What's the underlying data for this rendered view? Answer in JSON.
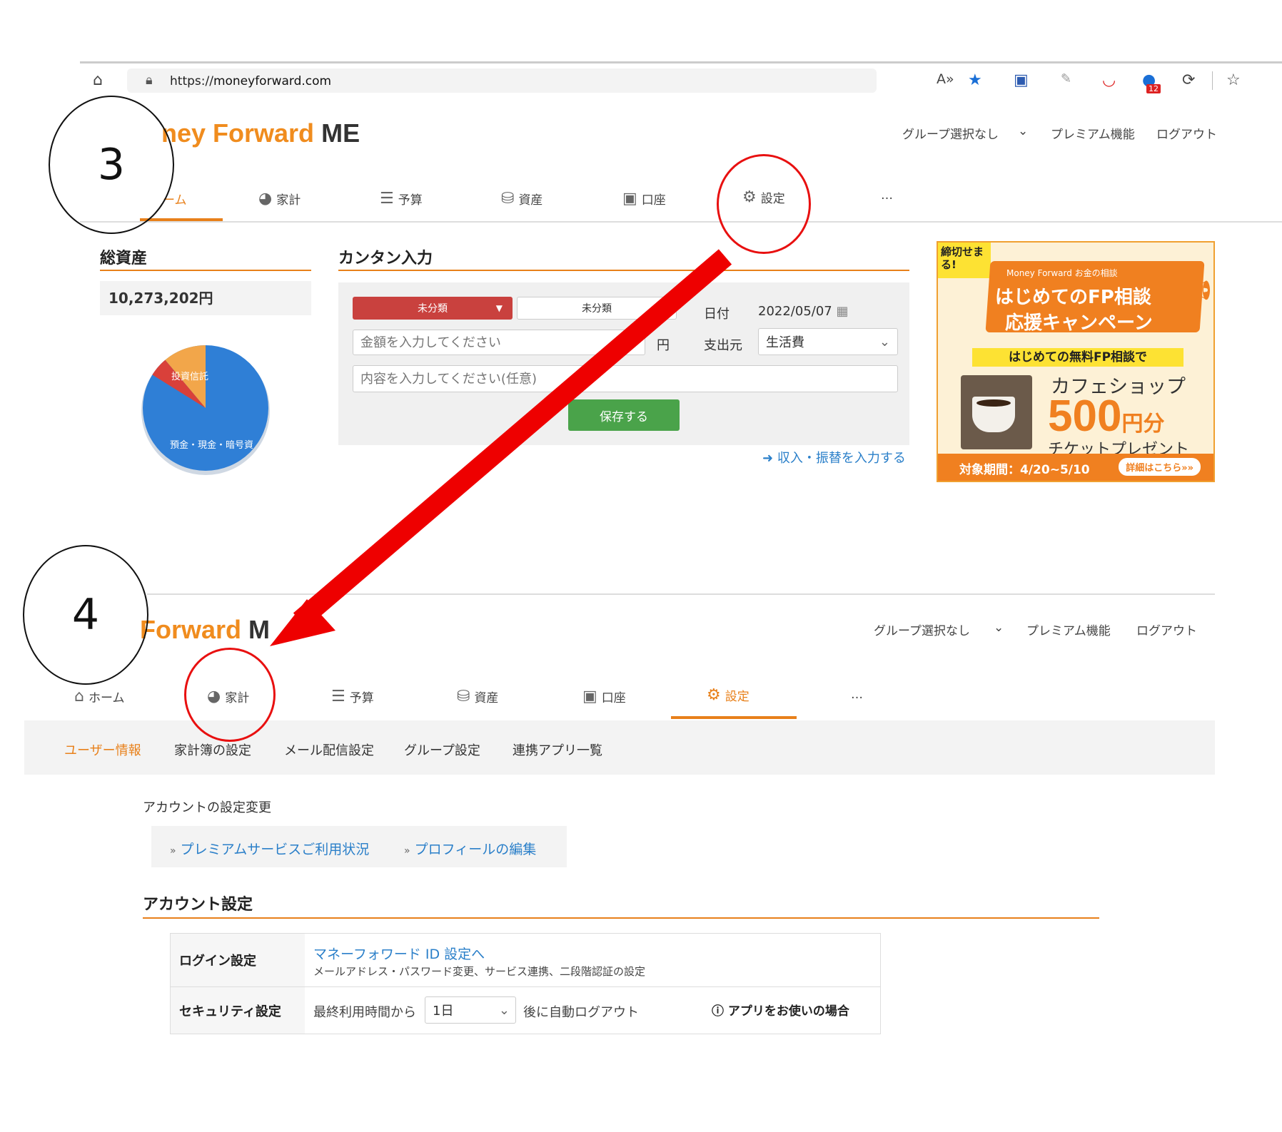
{
  "browser": {
    "url_prefix": "https://",
    "url_host": "moneyforward.com",
    "badge_count": "12"
  },
  "screen3": {
    "logo_main": "ney Forward",
    "logo_me": "ME",
    "top_links": [
      "グループ選択なし",
      "プレミアム機能",
      "ログアウト"
    ],
    "tabs": [
      "ーム",
      "家計",
      "予算",
      "資産",
      "口座",
      "設定",
      "…"
    ],
    "total_assets_title": "総資産",
    "total_assets_value": "10,273,202円",
    "pie": {
      "labels": [
        "投資信託",
        "預金・現金・暗号資"
      ],
      "colors": {
        "deposit": "#2f7fd6",
        "fund": "#f2a64a",
        "other": "#d9403a"
      }
    },
    "quick_title": "カンタン入力",
    "category_main": "未分類",
    "category_sub": "未分類",
    "date_label": "日付",
    "date_value": "2022/05/07",
    "amount_placeholder": "金額を入力してください",
    "yen_label": "円",
    "source_label": "支出元",
    "source_value": "生活費",
    "content_placeholder": "内容を入力してください(任意)",
    "save_button": "保存する",
    "income_link": "収入・振替を入力する"
  },
  "ad": {
    "corner": "締切せまる!",
    "brand": "Money Forward お金の相談",
    "headline1": "はじめてのFP相談",
    "headline2": "応援キャンペーン",
    "band": "はじめての無料FP相談で",
    "shop": "カフェショップ",
    "amount": "500",
    "amount_unit": "円分",
    "ticket": "チケットプレゼント",
    "period": "対象期間：4/20~5/10",
    "detail_button": "詳細はこちら»»"
  },
  "screen4": {
    "logo_main": "Forward",
    "logo_me": "M",
    "top_links": [
      "グループ選択なし",
      "プレミアム機能",
      "ログアウト"
    ],
    "tabs": [
      "ホーム",
      "家計",
      "予算",
      "資産",
      "口座",
      "設定",
      "…"
    ],
    "subnav": [
      "ユーザー情報",
      "家計簿の設定",
      "メール配信設定",
      "グループ設定",
      "連携アプリ一覧"
    ],
    "account_change_title": "アカウントの設定変更",
    "accordion": [
      "プレミアムサービスご利用状況",
      "プロフィールの編集"
    ],
    "account_settings_title": "アカウント設定",
    "login_label": "ログイン設定",
    "login_link": "マネーフォワード ID 設定へ",
    "login_desc": "メールアドレス・パスワード変更、サービス連携、二段階認証の設定",
    "security_label": "セキュリティ設定",
    "security_prefix": "最終利用時間から",
    "security_value": "1日",
    "security_suffix": "後に自動ログアウト",
    "app_note": "アプリをお使いの場合"
  },
  "annotations": {
    "step3": "3",
    "step4": "4"
  }
}
